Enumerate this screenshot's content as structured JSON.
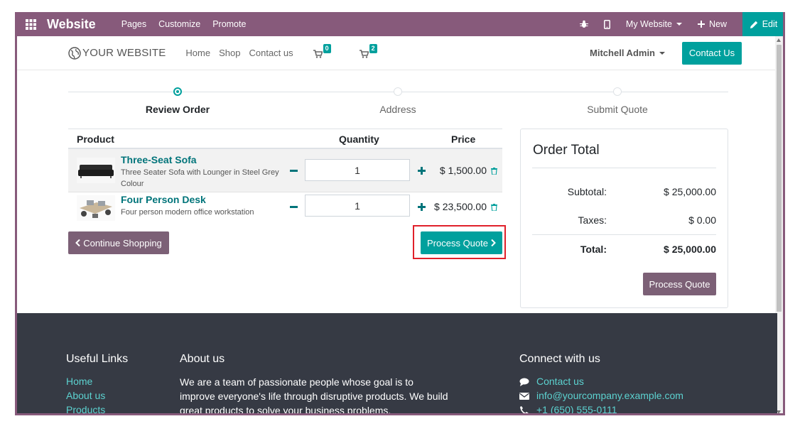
{
  "adminbar": {
    "brand": "Website",
    "menus": [
      "Pages",
      "Customize",
      "Promote"
    ],
    "site_selector": "My Website",
    "new_label": "New",
    "edit_label": "Edit"
  },
  "navbar": {
    "logo_text": "YOUR WEBSITE",
    "links": [
      "Home",
      "Shop",
      "Contact us"
    ],
    "cart1_count": "0",
    "cart2_count": "2",
    "user": "Mitchell Admin",
    "contact_button": "Contact Us"
  },
  "progress": {
    "steps": [
      "Review Order",
      "Address",
      "Submit Quote"
    ],
    "active_index": 0
  },
  "cart": {
    "headers": {
      "product": "Product",
      "quantity": "Quantity",
      "price": "Price"
    },
    "rows": [
      {
        "name": "Three-Seat Sofa",
        "description": "Three Seater Sofa with Lounger in Steel Grey Colour",
        "quantity": "1",
        "price": "$ 1,500.00"
      },
      {
        "name": "Four Person Desk",
        "description": "Four person modern office workstation",
        "quantity": "1",
        "price": "$ 23,500.00"
      }
    ],
    "continue_label": "Continue Shopping",
    "process_label": "Process Quote"
  },
  "order_total": {
    "title": "Order Total",
    "subtotal_label": "Subtotal:",
    "subtotal_value": "$ 25,000.00",
    "taxes_label": "Taxes:",
    "taxes_value": "$ 0.00",
    "total_label": "Total:",
    "total_value": "$ 25,000.00",
    "process_label": "Process Quote"
  },
  "footer": {
    "useful_links_title": "Useful Links",
    "useful_links": [
      "Home",
      "About us",
      "Products"
    ],
    "about_title": "About us",
    "about_text": "We are a team of passionate people whose goal is to improve everyone's life through disruptive products. We build great products to solve your business problems.",
    "connect_title": "Connect with us",
    "connect_contact": "Contact us",
    "connect_email": "info@yourcompany.example.com",
    "connect_phone": "+1 (650) 555-0111"
  },
  "colors": {
    "brand_purple": "#875a7b",
    "teal": "#00a09d",
    "footer_bg": "#363a44",
    "highlight_red": "#e0202a"
  }
}
